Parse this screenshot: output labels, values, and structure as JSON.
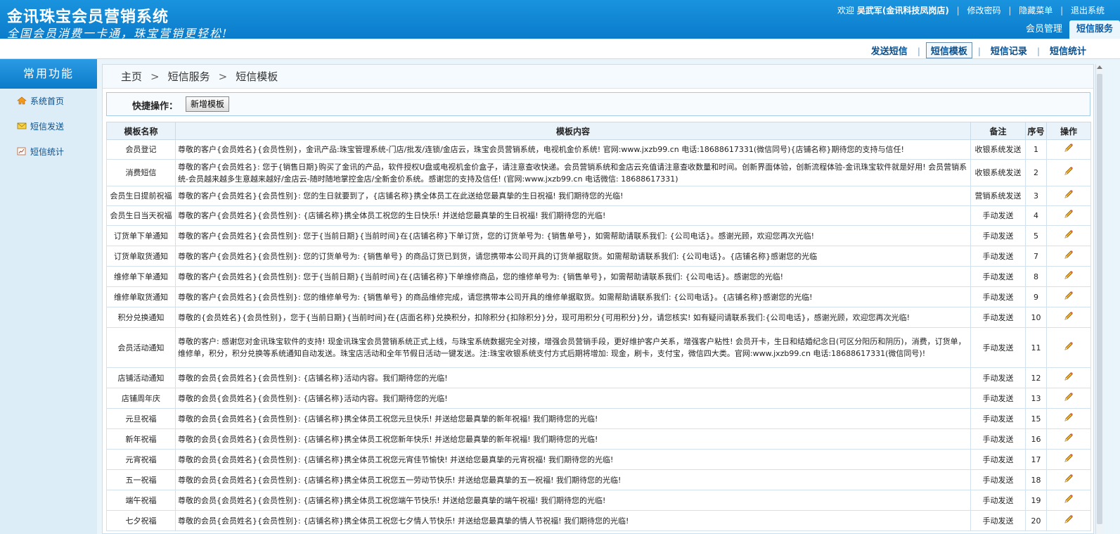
{
  "header": {
    "title": "金讯珠宝会员营销系统",
    "slogan": "全国会员消费一卡通，珠宝营销更轻松!",
    "welcome_prefix": "欢迎",
    "username": "吴武军(金讯科技凤岗店)",
    "links": [
      "修改密码",
      "隐藏菜单",
      "退出系统"
    ],
    "tabs": [
      "会员管理",
      "短信服务"
    ]
  },
  "subnav": {
    "items": [
      "发送短信",
      "短信模板",
      "短信记录",
      "短信统计"
    ]
  },
  "sidebar": {
    "title": "常用功能",
    "items": [
      {
        "label": "系统首页",
        "icon": "home-icon"
      },
      {
        "label": "短信发送",
        "icon": "mail-icon"
      },
      {
        "label": "短信统计",
        "icon": "chart-icon"
      }
    ]
  },
  "breadcrumb": [
    "主页",
    "短信服务",
    "短信模板"
  ],
  "quick": {
    "label": "快捷操作：",
    "button": "新增模板"
  },
  "table": {
    "headers": [
      "模板名称",
      "模板内容",
      "备注",
      "序号",
      "操作"
    ],
    "rows": [
      {
        "name": "会员登记",
        "content": "尊敬的客户{会员姓名}{会员性别}，金讯产品:珠宝管理系统-门店/批发/连锁/金店云，珠宝会员营销系统，电视机金价系统! 官网:www.jxzb99.cn 电话:18688617331(微信同号){店铺名称}期待您的支持与信任!",
        "note": "收银系统发送",
        "seq": "1"
      },
      {
        "name": "消费短信",
        "content": "尊敬的客户{会员姓名}: 您于{销售日期}购买了金讯的产品，软件授权U盘或电视机金价盒子，请注意查收快递。会员营销系统和金店云充值请注意查收数量和时间。创新界面体验，创新流程体验-金讯珠宝软件就是好用! 会员营销系统-会员越来越多生意越来越好/金店云-随时随地掌控金店/全新金价系统。感谢您的支持及信任! (官网:www.jxzb99.cn 电话微信: 18688617331)",
        "note": "收银系统发送",
        "seq": "2"
      },
      {
        "name": "会员生日提前祝福",
        "content": "尊敬的客户{会员姓名}{会员性别}: 您的生日就要到了，{店铺名称}携全体员工在此送给您最真挚的生日祝福! 我们期待您的光临!",
        "note": "营销系统发送",
        "seq": "3"
      },
      {
        "name": "会员生日当天祝福",
        "content": "尊敬的客户{会员姓名}{会员性别}: {店铺名称}携全体员工祝您的生日快乐! 并送给您最真挚的生日祝福! 我们期待您的光临!",
        "note": "手动发送",
        "seq": "4"
      },
      {
        "name": "订货单下单通知",
        "content": "尊敬的客户{会员姓名}{会员性别}: 您于{当前日期}{当前时间}在{店铺名称}下单订货，您的订货单号为: {销售单号}，如需帮助请联系我们: {公司电话}。感谢光顾，欢迎您再次光临!",
        "note": "手动发送",
        "seq": "5"
      },
      {
        "name": "订货单取货通知",
        "content": "尊敬的客户{会员姓名}{会员性别}: 您的订货单号为: {销售单号} 的商品订货已到货，请您携带本公司开具的订货单据取货。如需帮助请联系我们: {公司电话}。{店铺名称}感谢您的光临",
        "note": "手动发送",
        "seq": "7"
      },
      {
        "name": "维修单下单通知",
        "content": "尊敬的客户{会员姓名}{会员性别}: 您于{当前日期}{当前时间}在{店铺名称}下单维修商品，您的维修单号为: {销售单号}，如需帮助请联系我们: {公司电话}。感谢您的光临!",
        "note": "手动发送",
        "seq": "8"
      },
      {
        "name": "维修单取货通知",
        "content": "尊敬的客户{会员姓名}{会员性别}: 您的维修单号为: {销售单号} 的商品维修完成，请您携带本公司开具的维修单据取货。如需帮助请联系我们: {公司电话}。{店铺名称}感谢您的光临!",
        "note": "手动发送",
        "seq": "9"
      },
      {
        "name": "积分兑换通知",
        "content": "尊敬的{会员姓名}{会员性别}，您于{当前日期}{当前时间}在{店面名称}兑换积分，扣除积分{扣除积分}分，现可用积分{可用积分}分，请您核实! 如有疑问请联系我们:{公司电话}，感谢光顾，欢迎您再次光临!",
        "note": "手动发送",
        "seq": "10"
      },
      {
        "name": "会员活动通知",
        "content": "尊敬的客户: 感谢您对金讯珠宝软件的支持! 现金讯珠宝会员营销系统正式上线，与珠宝系统数据完全对接，增强会员营销手段，更好维护客户关系，增强客户粘性! 会员开卡，生日和结婚纪念日(可区分阳历和阴历)，消费，订货单，维修单，积分，积分兑换等系统通知自动发送。珠宝店活动和全年节假日活动一键发送。注:珠宝收银系统支付方式后期将增加: 现金，刷卡，支付宝，微信四大类。官网:www.jxzb99.cn 电话:18688617331(微信同号)!",
        "note": "手动发送",
        "seq": "11"
      },
      {
        "name": "店铺活动通知",
        "content": "尊敬的会员{会员姓名}{会员性别}: {店铺名称}活动内容。我们期待您的光临!",
        "note": "手动发送",
        "seq": "12"
      },
      {
        "name": "店铺周年庆",
        "content": "尊敬的会员{会员姓名}{会员性别}: {店铺名称}活动内容。我们期待您的光临!",
        "note": "手动发送",
        "seq": "13"
      },
      {
        "name": "元旦祝福",
        "content": "尊敬的会员{会员姓名}{会员性别}: {店铺名称}携全体员工祝您元旦快乐! 并送给您最真挚的新年祝福! 我们期待您的光临!",
        "note": "手动发送",
        "seq": "15"
      },
      {
        "name": "新年祝福",
        "content": "尊敬的会员{会员姓名}{会员性别}: {店铺名称}携全体员工祝您新年快乐! 并送给您最真挚的新年祝福! 我们期待您的光临!",
        "note": "手动发送",
        "seq": "16"
      },
      {
        "name": "元宵祝福",
        "content": "尊敬的会员{会员姓名}{会员性别}: {店铺名称}携全体员工祝您元宵佳节愉快! 并送给您最真挚的元宵祝福! 我们期待您的光临!",
        "note": "手动发送",
        "seq": "17"
      },
      {
        "name": "五一祝福",
        "content": "尊敬的会员{会员姓名}{会员性别}: {店铺名称}携全体员工祝您五一劳动节快乐! 并送给您最真挚的五一祝福! 我们期待您的光临!",
        "note": "手动发送",
        "seq": "18"
      },
      {
        "name": "端午祝福",
        "content": "尊敬的会员{会员姓名}{会员性别}: {店铺名称}携全体员工祝您端午节快乐! 并送给您最真挚的端午祝福! 我们期待您的光临!",
        "note": "手动发送",
        "seq": "19"
      },
      {
        "name": "七夕祝福",
        "content": "尊敬的会员{会员姓名}{会员性别}: {店铺名称}携全体员工祝您七夕情人节快乐! 并送给您最真挚的情人节祝福! 我们期待您的光临!",
        "note": "手动发送",
        "seq": "20"
      }
    ]
  },
  "colors": {
    "header_blue": "#0a7ccb",
    "link_blue": "#0a4f8c",
    "page_bg": "#e9f4fb"
  }
}
